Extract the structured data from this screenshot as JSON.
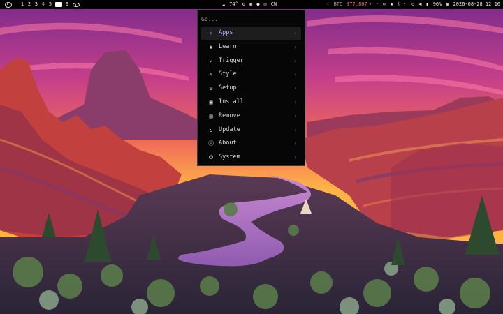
{
  "topbar": {
    "workspaces": [
      "1",
      "2",
      "3",
      "4",
      "5",
      "9"
    ],
    "weather_temp": "74°",
    "cw_label": "CW",
    "btc_label": "BTC",
    "btc_value": "$77,867",
    "battery": "96%",
    "datetime": "2026-08-28 12:16"
  },
  "launcher": {
    "search_placeholder": "Go...",
    "items": [
      {
        "label": "Apps",
        "icon": "grid-icon"
      },
      {
        "label": "Learn",
        "icon": "brain-icon"
      },
      {
        "label": "Trigger",
        "icon": "rocket-icon"
      },
      {
        "label": "Style",
        "icon": "palette-icon"
      },
      {
        "label": "Setup",
        "icon": "gear-icon"
      },
      {
        "label": "Install",
        "icon": "floppy-icon"
      },
      {
        "label": "Remove",
        "icon": "trash-icon"
      },
      {
        "label": "Update",
        "icon": "refresh-icon"
      },
      {
        "label": "About",
        "icon": "info-icon"
      },
      {
        "label": "System",
        "icon": "power-icon"
      }
    ],
    "selected_index": 0
  },
  "colors": {
    "accent": "#b8a6ff",
    "btc": "#ff5f5f",
    "bar_bg": "#000000",
    "menu_bg": "#060606"
  }
}
